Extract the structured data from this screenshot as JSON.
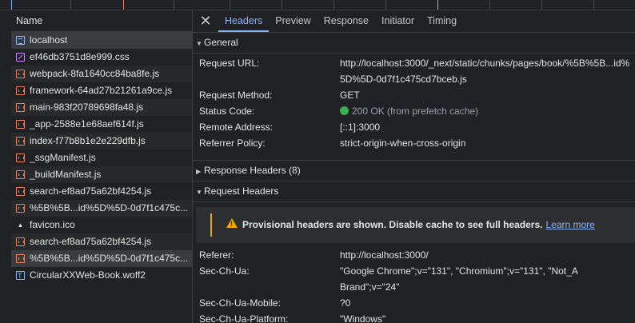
{
  "colors": {
    "accent": "#8ab4f8",
    "warning": "#f2a600",
    "status_ok": "#37b24d",
    "js_icon": "#e8845d",
    "css_icon": "#c58af9"
  },
  "request_list": {
    "header": "Name",
    "items": [
      {
        "name": "localhost",
        "icon": "document-icon"
      },
      {
        "name": "ef46db3751d8e999.css",
        "icon": "stylesheet-icon"
      },
      {
        "name": "webpack-8fa1640cc84ba8fe.js",
        "icon": "script-icon"
      },
      {
        "name": "framework-64ad27b21261a9ce.js",
        "icon": "script-icon"
      },
      {
        "name": "main-983f20789698fa48.js",
        "icon": "script-icon"
      },
      {
        "name": "_app-2588e1e68aef614f.js",
        "icon": "script-icon"
      },
      {
        "name": "index-f77b8b1e2e229dfb.js",
        "icon": "script-icon"
      },
      {
        "name": "_ssgManifest.js",
        "icon": "script-icon"
      },
      {
        "name": "_buildManifest.js",
        "icon": "script-icon"
      },
      {
        "name": "search-ef8ad75a62bf4254.js",
        "icon": "script-icon"
      },
      {
        "name": "%5B%5B...id%5D%5D-0d7f1c475c...",
        "icon": "script-icon"
      },
      {
        "name": "favicon.ico",
        "icon": "favicon-icon"
      },
      {
        "name": "search-ef8ad75a62bf4254.js",
        "icon": "script-icon"
      },
      {
        "name": "%5B%5B...id%5D%5D-0d7f1c475c...",
        "icon": "script-icon"
      },
      {
        "name": "CircularXXWeb-Book.woff2",
        "icon": "font-icon"
      }
    ]
  },
  "tabs": [
    "Headers",
    "Preview",
    "Response",
    "Initiator",
    "Timing"
  ],
  "general": {
    "title": "General",
    "request_url_label": "Request URL:",
    "request_url": "http://localhost:3000/_next/static/chunks/pages/book/%5B%5B...id%5D%5D-0d7f1c475cd7bceb.js",
    "request_method_label": "Request Method:",
    "request_method": "GET",
    "status_code_label": "Status Code:",
    "status_code": "200 OK (from prefetch cache)",
    "remote_address_label": "Remote Address:",
    "remote_address": "[::1]:3000",
    "referrer_policy_label": "Referrer Policy:",
    "referrer_policy": "strict-origin-when-cross-origin"
  },
  "response_headers": {
    "title": "Response Headers (8)"
  },
  "request_headers": {
    "title": "Request Headers",
    "warning_text": "Provisional headers are shown. Disable cache to see full headers.",
    "learn_more": "Learn more",
    "referer_label": "Referer:",
    "referer": "http://localhost:3000/",
    "sec_ch_ua_label": "Sec-Ch-Ua:",
    "sec_ch_ua": "\"Google Chrome\";v=\"131\", \"Chromium\";v=\"131\", \"Not_A Brand\";v=\"24\"",
    "sec_ch_ua_mobile_label": "Sec-Ch-Ua-Mobile:",
    "sec_ch_ua_mobile": "?0",
    "sec_ch_ua_platform_label": "Sec-Ch-Ua-Platform:",
    "sec_ch_ua_platform": "\"Windows\""
  }
}
